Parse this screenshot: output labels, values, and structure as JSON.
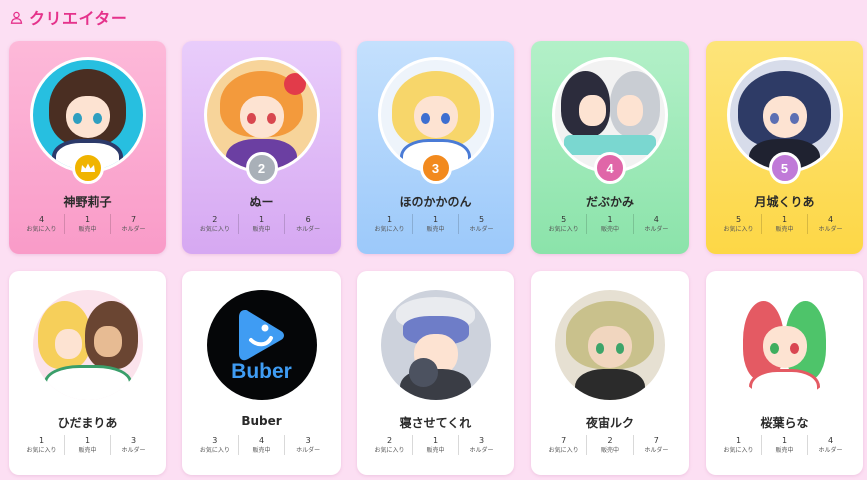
{
  "header": {
    "title": "クリエイター",
    "icon": "user-icon",
    "accent": "#e5328b"
  },
  "stat_labels": {
    "favorites": "お気に入り",
    "on_sale": "販売中",
    "holders": "ホルダー"
  },
  "creators": [
    {
      "name": "神野莉子",
      "rank": "",
      "rank_icon": "crown-icon",
      "favorites": "4",
      "on_sale": "1",
      "holders": "7"
    },
    {
      "name": "ぬー",
      "rank": "2",
      "favorites": "2",
      "on_sale": "1",
      "holders": "6"
    },
    {
      "name": "ほのかかのん",
      "rank": "3",
      "favorites": "1",
      "on_sale": "1",
      "holders": "5"
    },
    {
      "name": "だぶかみ",
      "rank": "4",
      "favorites": "5",
      "on_sale": "1",
      "holders": "4"
    },
    {
      "name": "月城くりあ",
      "rank": "5",
      "favorites": "5",
      "on_sale": "1",
      "holders": "4"
    },
    {
      "name": "ひだまりあ",
      "favorites": "1",
      "on_sale": "1",
      "holders": "3"
    },
    {
      "name": "Buber",
      "logo_text": "Buber",
      "favorites": "3",
      "on_sale": "4",
      "holders": "3"
    },
    {
      "name": "寝させてくれ",
      "favorites": "2",
      "on_sale": "1",
      "holders": "3"
    },
    {
      "name": "夜宙ルク",
      "favorites": "7",
      "on_sale": "2",
      "holders": "7"
    },
    {
      "name": "桜葉らな",
      "favorites": "1",
      "on_sale": "1",
      "holders": "4"
    }
  ],
  "colors": {
    "background": "#fcdff3",
    "rank1": "#f0b400",
    "rank2": "#a9b0b8",
    "rank3": "#f28a1e",
    "rank4": "#e066a8",
    "rank5": "#c07ad8"
  }
}
